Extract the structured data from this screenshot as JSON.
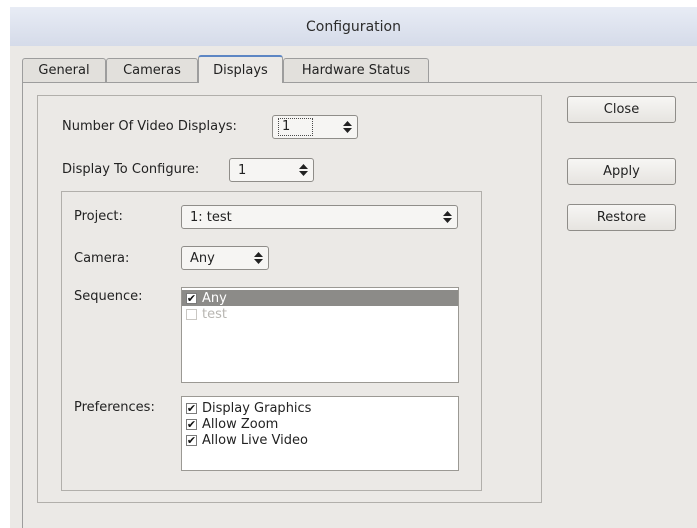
{
  "window": {
    "title": "Configuration"
  },
  "tabs": [
    {
      "label": "General",
      "active": false
    },
    {
      "label": "Cameras",
      "active": false
    },
    {
      "label": "Displays",
      "active": true
    },
    {
      "label": "Hardware Status",
      "active": false
    }
  ],
  "displays": {
    "num_displays_label": "Number Of Video Displays:",
    "num_displays_value": "1",
    "display_to_configure_label": "Display To Configure:",
    "display_to_configure_value": "1",
    "project_label": "Project:",
    "project_value": "1: test",
    "camera_label": "Camera:",
    "camera_value": "Any",
    "sequence_label": "Sequence:",
    "sequence_items": [
      {
        "label": "Any",
        "checked": true,
        "selected": true,
        "enabled": true
      },
      {
        "label": "test",
        "checked": false,
        "selected": false,
        "enabled": false
      }
    ],
    "preferences_label": "Preferences:",
    "preferences_items": [
      {
        "label": "Display Graphics",
        "checked": true
      },
      {
        "label": "Allow Zoom",
        "checked": true
      },
      {
        "label": "Allow Live Video",
        "checked": true
      }
    ]
  },
  "buttons": {
    "close": "Close",
    "apply": "Apply",
    "restore": "Restore"
  },
  "icons": {
    "combo_arrows": "updown-arrows-icon",
    "checkmark": "check-icon"
  },
  "colors": {
    "active_tab_accent": "#5d86c4",
    "selection": "#8c8b88",
    "window_bg": "#ebe9e6"
  }
}
